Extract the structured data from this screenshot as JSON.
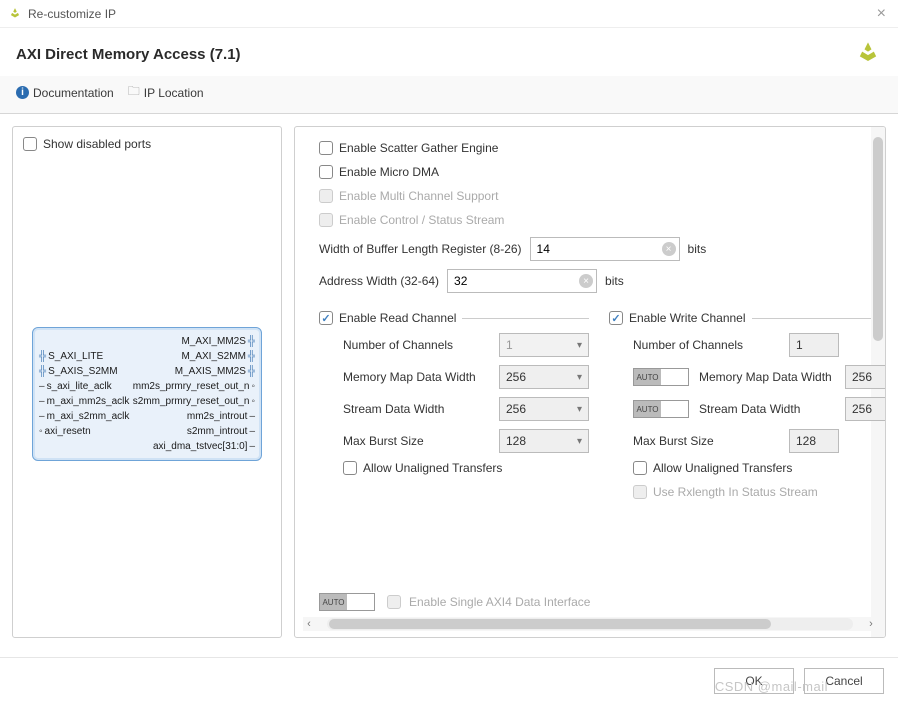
{
  "window": {
    "title": "Re-customize IP"
  },
  "header": {
    "title": "AXI Direct Memory Access (7.1)"
  },
  "toolbar": {
    "doc": "Documentation",
    "loc": "IP Location"
  },
  "left": {
    "show_disabled_label": "Show disabled ports",
    "block": {
      "left_ports": [
        "S_AXI_LITE",
        "S_AXIS_S2MM",
        "s_axi_lite_aclk",
        "m_axi_mm2s_aclk",
        "m_axi_s2mm_aclk",
        "axi_resetn",
        ""
      ],
      "right_ports": [
        "M_AXI_MM2S",
        "M_AXI_S2MM",
        "M_AXIS_MM2S",
        "mm2s_prmry_reset_out_n",
        "s2mm_prmry_reset_out_n",
        "mm2s_introut",
        "s2mm_introut",
        "axi_dma_tstvec[31:0]"
      ]
    }
  },
  "right": {
    "options": {
      "scatter_gather": "Enable Scatter Gather Engine",
      "micro_dma": "Enable Micro DMA",
      "multi_channel": "Enable Multi Channel Support",
      "ctrl_status": "Enable Control / Status Stream"
    },
    "buf_len": {
      "label": "Width of Buffer Length Register (8-26)",
      "value": "14",
      "unit": "bits"
    },
    "addr_width": {
      "label": "Address Width (32-64)",
      "value": "32",
      "unit": "bits"
    },
    "read": {
      "title": "Enable Read Channel",
      "num_channels_label": "Number of Channels",
      "num_channels_value": "1",
      "mem_map_label": "Memory Map Data Width",
      "mem_map_value": "256",
      "stream_label": "Stream Data Width",
      "stream_value": "256",
      "burst_label": "Max Burst Size",
      "burst_value": "128",
      "allow_unaligned": "Allow Unaligned Transfers"
    },
    "write": {
      "title": "Enable Write Channel",
      "num_channels_label": "Number of Channels",
      "num_channels_value": "1",
      "mem_map_label": "Memory Map Data Width",
      "mem_map_value": "256",
      "stream_label": "Stream Data Width",
      "stream_value": "256",
      "burst_label": "Max Burst Size",
      "burst_value": "128",
      "allow_unaligned": "Allow Unaligned Transfers",
      "use_rxlength": "Use Rxlength In Status Stream"
    },
    "single_axi4": "Enable Single AXI4 Data Interface",
    "auto_label": "AUTO"
  },
  "footer": {
    "ok": "OK",
    "cancel": "Cancel"
  },
  "watermark": "CSDN @mail-mail"
}
